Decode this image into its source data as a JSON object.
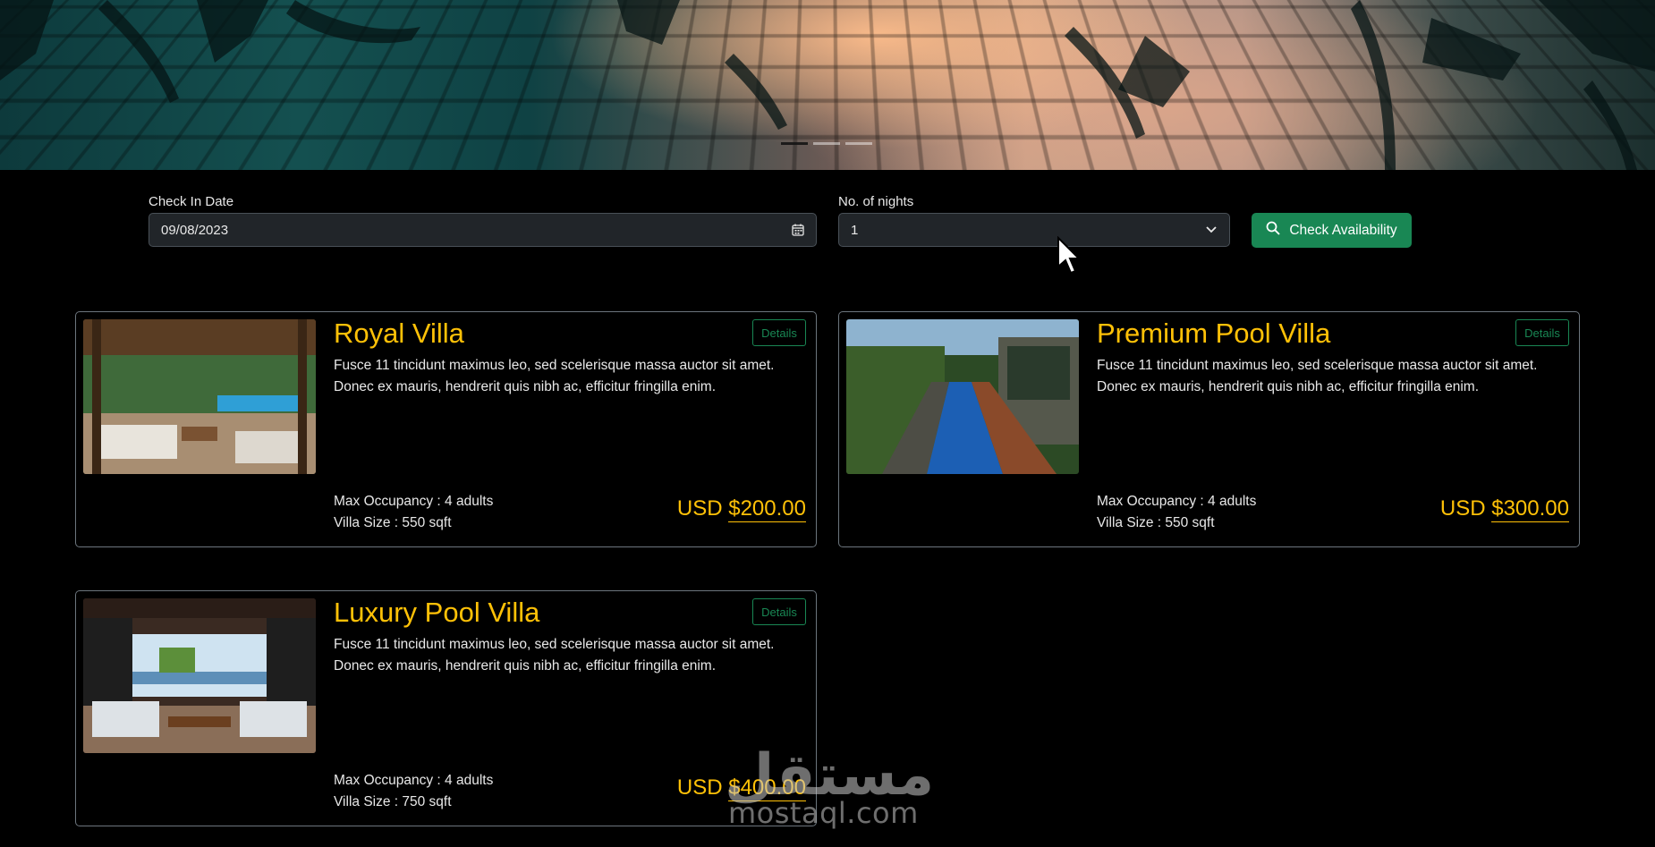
{
  "search": {
    "checkin_label": "Check In Date",
    "checkin_value": "09/08/2023",
    "nights_label": "No. of nights",
    "nights_value": "1",
    "button_label": "Check Availability"
  },
  "carousel": {
    "slides": 3,
    "active_index": 0
  },
  "villas": [
    {
      "name": "Royal Villa",
      "description": "Fusce 11 tincidunt maximus leo, sed scelerisque massa auctor sit amet. Donec ex mauris, hendrerit quis nibh ac, efficitur fringilla enim.",
      "details_label": "Details",
      "occupancy": "Max Occupancy : 4 adults",
      "size": "Villa Size : 550 sqft",
      "currency": "USD",
      "price": "$200.00"
    },
    {
      "name": "Premium Pool Villa",
      "description": "Fusce 11 tincidunt maximus leo, sed scelerisque massa auctor sit amet. Donec ex mauris, hendrerit quis nibh ac, efficitur fringilla enim.",
      "details_label": "Details",
      "occupancy": "Max Occupancy : 4 adults",
      "size": "Villa Size : 550 sqft",
      "currency": "USD",
      "price": "$300.00"
    },
    {
      "name": "Luxury Pool Villa",
      "description": "Fusce 11 tincidunt maximus leo, sed scelerisque massa auctor sit amet. Donec ex mauris, hendrerit quis nibh ac, efficitur fringilla enim.",
      "details_label": "Details",
      "occupancy": "Max Occupancy : 4 adults",
      "size": "Villa Size : 750 sqft",
      "currency": "USD",
      "price": "$400.00"
    }
  ],
  "watermark": {
    "arabic": "مستقل",
    "latin": "mostaql.com"
  },
  "colors": {
    "accent": "#ffc107",
    "success": "#198754",
    "background": "#000000"
  }
}
